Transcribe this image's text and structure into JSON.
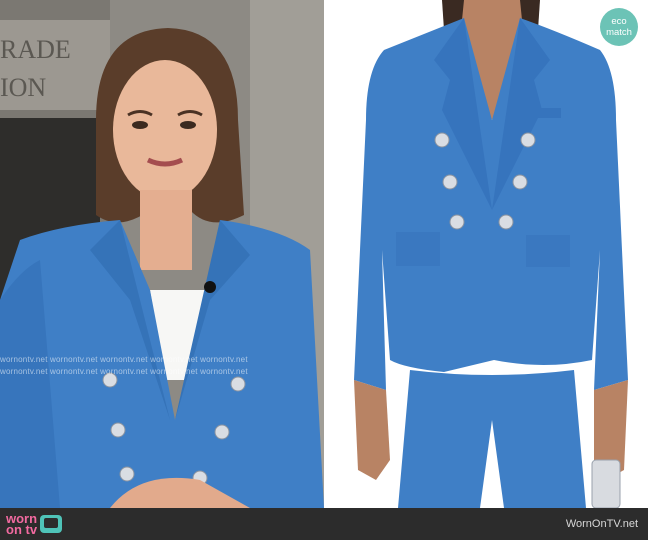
{
  "images": {
    "left_alt": "",
    "right_alt": ""
  },
  "building_sign": {
    "line1": "RADE",
    "line2": "ION"
  },
  "watermark": {
    "text": "wornontv.net wornontv.net wornontv.net wornontv.net wornontv.net"
  },
  "eco_badge": {
    "line1": "eco",
    "line2": "match"
  },
  "footer": {
    "logo_line1": "worn",
    "logo_line2": "on tv",
    "site_name": "WornOnTV.net"
  },
  "colors": {
    "blazer_blue": "#3f7fc6",
    "background_gray": "#8f8c86",
    "footer_bg": "#2c2c2c",
    "logo_pink": "#f26aa0",
    "logo_teal": "#4fc3b8",
    "badge_teal": "#6cc3b6"
  }
}
